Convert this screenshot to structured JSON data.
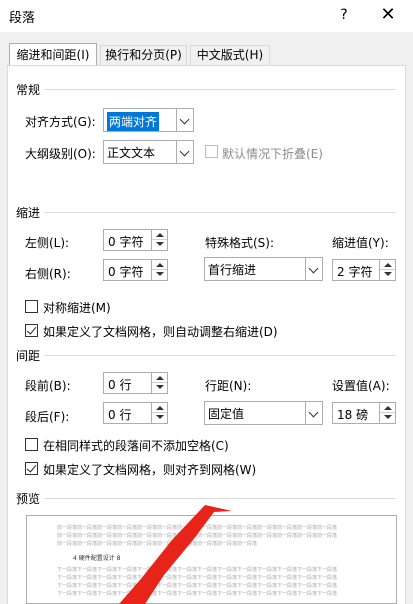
{
  "window": {
    "title": "段落",
    "help": "?",
    "close": "✕"
  },
  "tabs": [
    {
      "label": "缩进和间距(I)",
      "active": true
    },
    {
      "label": "换行和分页(P)",
      "active": false
    },
    {
      "label": "中文版式(H)",
      "active": false
    }
  ],
  "general": {
    "title": "常规",
    "alignment_label": "对齐方式(G):",
    "alignment_value": "两端对齐",
    "outline_label": "大纲级别(O):",
    "outline_value": "正文文本",
    "collapse_label": "默认情况下折叠(E)"
  },
  "indent": {
    "title": "缩进",
    "left_label": "左侧(L):",
    "left_value": "0 字符",
    "right_label": "右侧(R):",
    "right_value": "0 字符",
    "special_label": "特殊格式(S):",
    "special_value": "首行缩进",
    "by_label": "缩进值(Y):",
    "by_value": "2 字符",
    "mirror_label": "对称缩进(M)",
    "auto_adjust_label": "如果定义了文档网格，则自动调整右缩进(D)"
  },
  "spacing": {
    "title": "间距",
    "before_label": "段前(B):",
    "before_value": "0 行",
    "after_label": "段后(F):",
    "after_value": "0 行",
    "line_label": "行距(N):",
    "line_value": "固定值",
    "at_label": "设置值(A):",
    "at_value": "18 磅",
    "no_space_label": "在相同样式的段落间不添加空格(C)",
    "snap_grid_label": "如果定义了文档网格，则对齐到网格(W)"
  },
  "preview": {
    "title": "预览",
    "prev_text": "前一段落前一段落前一段落前一段落前一段落前一段落前一段落前一段落前一段落前一段落前一段落前一段落前一段落前一段落",
    "sample_text": "4    硬件配置设计    8",
    "next_text": "下一段落下一段落下一段落下一段落下一段落下一段落下一段落下一段落下一段落下一段落下一段落下一段落下一段落下一段落"
  },
  "colors": {
    "accent": "#0078d7",
    "annotation_arrow": "#e8231a"
  }
}
